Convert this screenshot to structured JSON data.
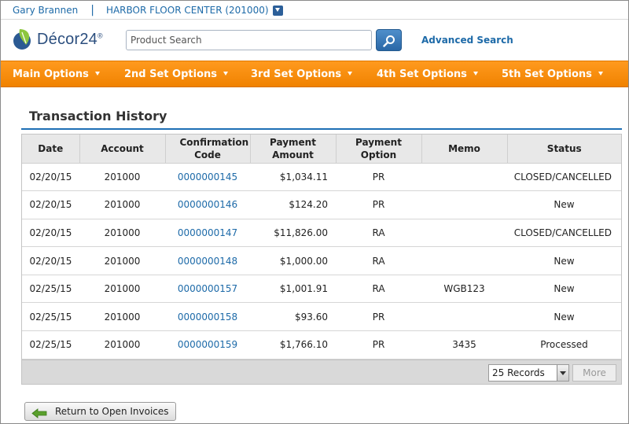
{
  "userbar": {
    "user_name": "Gary Brannen",
    "separator": "|",
    "store": "HARBOR FLOOR CENTER (201000)"
  },
  "header": {
    "logo_text": "Décor24",
    "logo_mark": "®",
    "search_placeholder": "Product Search",
    "advanced_search": "Advanced Search"
  },
  "nav": {
    "items": [
      {
        "label": "Main Options"
      },
      {
        "label": "2nd Set Options"
      },
      {
        "label": "3rd Set Options"
      },
      {
        "label": "4th Set Options"
      },
      {
        "label": "5th Set Options"
      }
    ]
  },
  "page": {
    "title": "Transaction History"
  },
  "table": {
    "columns": [
      "Date",
      "Account",
      "Confirmation Code",
      "Payment Amount",
      "Payment Option",
      "Memo",
      "Status"
    ],
    "rows": [
      {
        "date": "02/20/15",
        "account": "201000",
        "code": "0000000145",
        "amount": "$1,034.11",
        "option": "PR",
        "memo": "",
        "status": "CLOSED/CANCELLED"
      },
      {
        "date": "02/20/15",
        "account": "201000",
        "code": "0000000146",
        "amount": "$124.20",
        "option": "PR",
        "memo": "",
        "status": "New"
      },
      {
        "date": "02/20/15",
        "account": "201000",
        "code": "0000000147",
        "amount": "$11,826.00",
        "option": "RA",
        "memo": "",
        "status": "CLOSED/CANCELLED"
      },
      {
        "date": "02/20/15",
        "account": "201000",
        "code": "0000000148",
        "amount": "$1,000.00",
        "option": "RA",
        "memo": "",
        "status": "New"
      },
      {
        "date": "02/25/15",
        "account": "201000",
        "code": "0000000157",
        "amount": "$1,001.91",
        "option": "RA",
        "memo": "WGB123",
        "status": "New"
      },
      {
        "date": "02/25/15",
        "account": "201000",
        "code": "0000000158",
        "amount": "$93.60",
        "option": "PR",
        "memo": "",
        "status": "New"
      },
      {
        "date": "02/25/15",
        "account": "201000",
        "code": "0000000159",
        "amount": "$1,766.10",
        "option": "PR",
        "memo": "3435",
        "status": "Processed"
      }
    ]
  },
  "footer": {
    "records_selected": "25 Records",
    "more_label": "More"
  },
  "actions": {
    "return_label": "Return to Open Invoices"
  },
  "colors": {
    "nav_orange": "#f58a0b",
    "link_blue": "#1d6aa8",
    "rule_blue": "#1e6fb5"
  }
}
